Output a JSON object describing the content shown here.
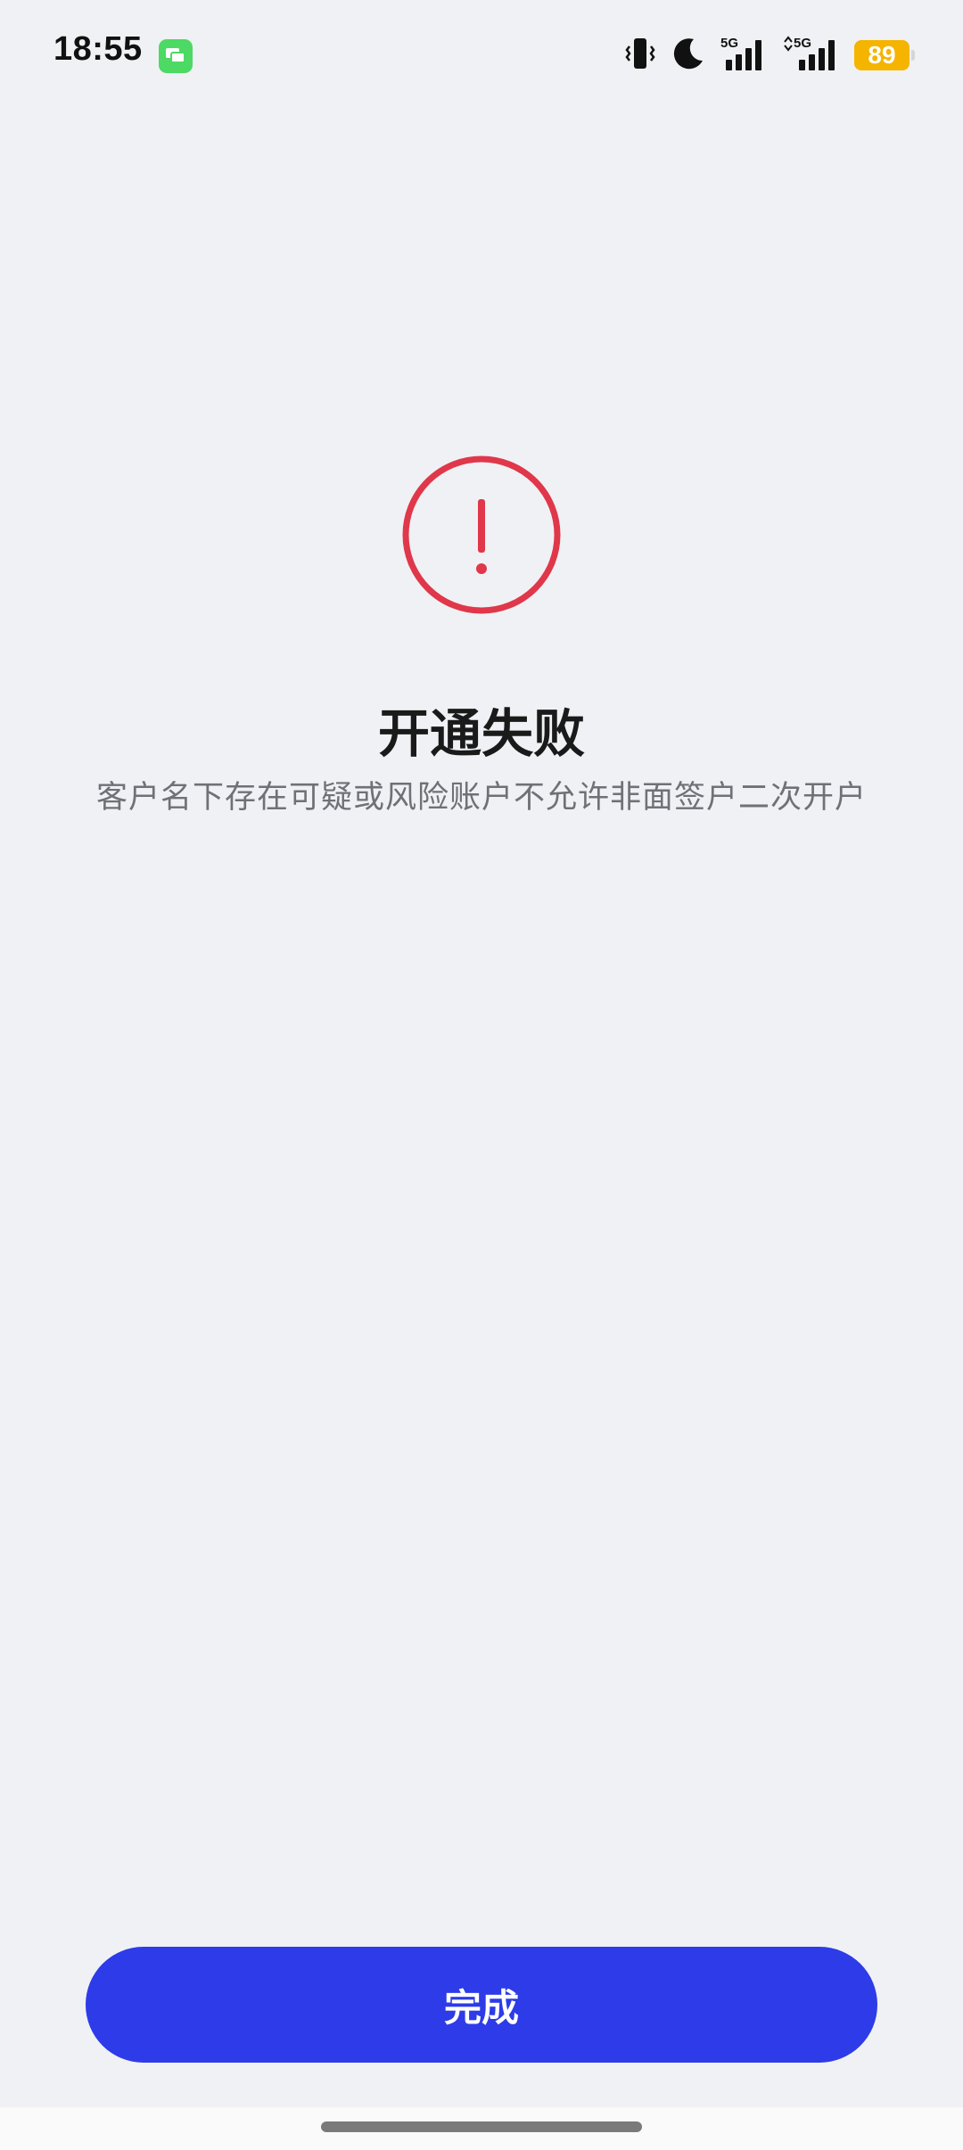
{
  "status_bar": {
    "time": "18:55",
    "battery_level": "89",
    "network_1": "5G",
    "network_2": "5G",
    "icons": [
      "message-app-icon",
      "vibrate-icon",
      "do-not-disturb-moon-icon",
      "signal-5g-icon",
      "signal-5g-data-icon",
      "battery-icon"
    ]
  },
  "result": {
    "icon": "exclamation-circle-icon",
    "status_color": "#e0374a",
    "title": "开通失败",
    "description": "客户名下存在可疑或风险账户不允许非面签户二次开户"
  },
  "actions": {
    "done_label": "完成",
    "accent_color": "#2d3be8"
  }
}
